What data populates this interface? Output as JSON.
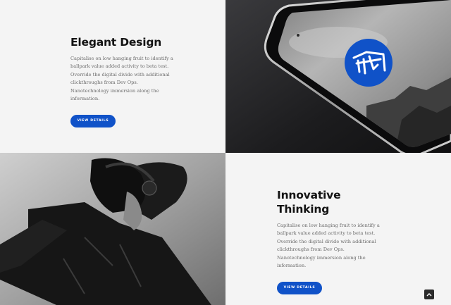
{
  "features": [
    {
      "title": "Elegant Design",
      "body": "Capitalise on low hanging fruit to identify a ballpark value added activity to beta test. Override the digital divide with additional clickthroughs from Dev Ops. Nanotechnology immersion along the information.",
      "button_label": "VIEW DETAILS"
    },
    {
      "title": "Innovative Thinking",
      "body": "Capitalise on low hanging fruit to identify a ballpark value added activity to beta test. Override the digital divide with additional clickthroughs from Dev Ops. Nanotechnology immersion along the information.",
      "button_label": "VIEW DETAILS"
    }
  ],
  "images": {
    "phone": "phone-mockup-image",
    "portrait": "person-with-headphones-image"
  },
  "colors": {
    "accent": "#1052c8",
    "background": "#f4f4f4",
    "heading": "#141414",
    "body_text": "#6b6b6b"
  },
  "scroll_top": {
    "icon": "chevron-up-icon"
  }
}
